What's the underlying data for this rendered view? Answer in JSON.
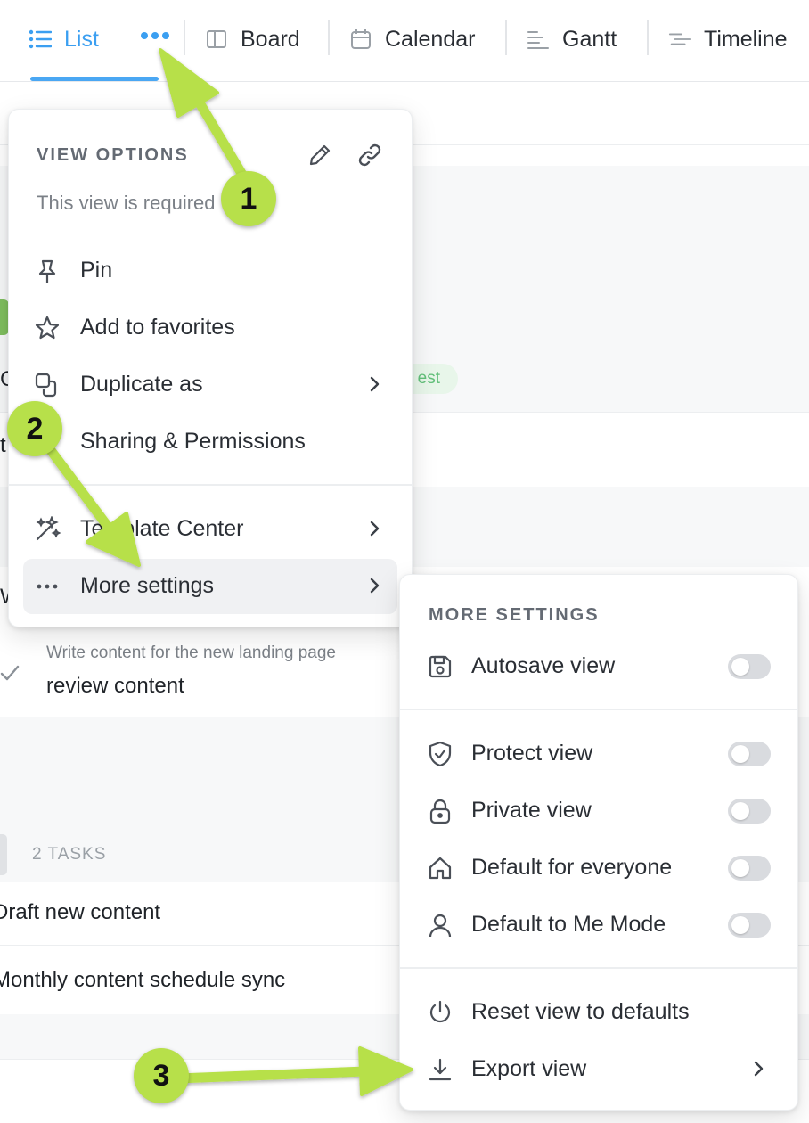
{
  "tabs": {
    "list": "List",
    "board": "Board",
    "calendar": "Calendar",
    "gantt": "Gantt",
    "timeline": "Timeline"
  },
  "background": {
    "fragment_co": "Co",
    "fragment_t": "t",
    "fragment_w": "W",
    "tag": "est",
    "task_subtitle": "Write content for the new landing page",
    "task_title": "review content",
    "group_count": "2 TASKS",
    "row_1": "Draft new content",
    "row_2": "Monthly content schedule sync"
  },
  "view_options": {
    "heading": "VIEW OPTIONS",
    "note": "This view is required",
    "items": [
      {
        "label": "Pin",
        "icon": "pin-icon"
      },
      {
        "label": "Add to favorites",
        "icon": "star-icon"
      },
      {
        "label": "Duplicate as",
        "icon": "duplicate-icon"
      },
      {
        "label": "Sharing & Permissions",
        "icon": "share-icon"
      },
      {
        "label": "Template Center",
        "icon": "magic-wand-icon"
      },
      {
        "label": "More settings",
        "icon": "more-icon"
      }
    ]
  },
  "more_settings": {
    "heading": "MORE SETTINGS",
    "items": [
      {
        "label": "Autosave view",
        "icon": "save-icon",
        "toggle": false
      },
      {
        "label": "Protect view",
        "icon": "shield-icon",
        "toggle": false
      },
      {
        "label": "Private view",
        "icon": "lock-icon",
        "toggle": false
      },
      {
        "label": "Default for everyone",
        "icon": "home-icon",
        "toggle": false
      },
      {
        "label": "Default to Me Mode",
        "icon": "user-icon",
        "toggle": false
      },
      {
        "label": "Reset view to defaults",
        "icon": "power-icon"
      },
      {
        "label": "Export view",
        "icon": "download-icon"
      }
    ]
  },
  "annotations": {
    "step_1": "1",
    "step_2": "2",
    "step_3": "3",
    "color": "#b7e04a"
  },
  "colors": {
    "accent": "#3b9ff1",
    "toggle_off": "#d9dbdf"
  }
}
